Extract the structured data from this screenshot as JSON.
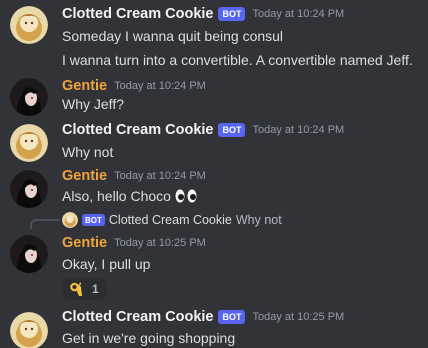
{
  "messages": [
    {
      "author": "Clotted Cream Cookie",
      "bot_tag": "BOT",
      "timestamp": "Today at 10:24 PM",
      "lines": [
        "Someday I wanna quit being consul",
        "I wanna turn into a convertible. A convertible named Jeff."
      ]
    },
    {
      "author": "Gentie",
      "timestamp": "Today at 10:24 PM",
      "lines": [
        "Why Jeff?"
      ]
    },
    {
      "author": "Clotted Cream Cookie",
      "bot_tag": "BOT",
      "timestamp": "Today at 10:24 PM",
      "lines": [
        "Why not"
      ]
    },
    {
      "author": "Gentie",
      "timestamp": "Today at 10:24 PM",
      "lines": [
        "Also, hello Choco"
      ]
    },
    {
      "reply": {
        "bot_tag": "BOT",
        "author": "Clotted Cream Cookie",
        "text": "Why not"
      },
      "author": "Gentie",
      "timestamp": "Today at 10:25 PM",
      "lines": [
        "Okay, I pull up"
      ],
      "reaction": {
        "emoji": "ok-hand",
        "count": "1"
      }
    },
    {
      "author": "Clotted Cream Cookie",
      "bot_tag": "BOT",
      "timestamp": "Today at 10:25 PM",
      "lines": [
        "Get in we're going shopping"
      ]
    }
  ],
  "colors": {
    "background": "#313338",
    "bot_tag": "#5865f2",
    "gentie_name": "#f0a43b",
    "cookie_name": "#f2f3f5",
    "timestamp": "#949ba4",
    "message_text": "#dbdee1"
  }
}
